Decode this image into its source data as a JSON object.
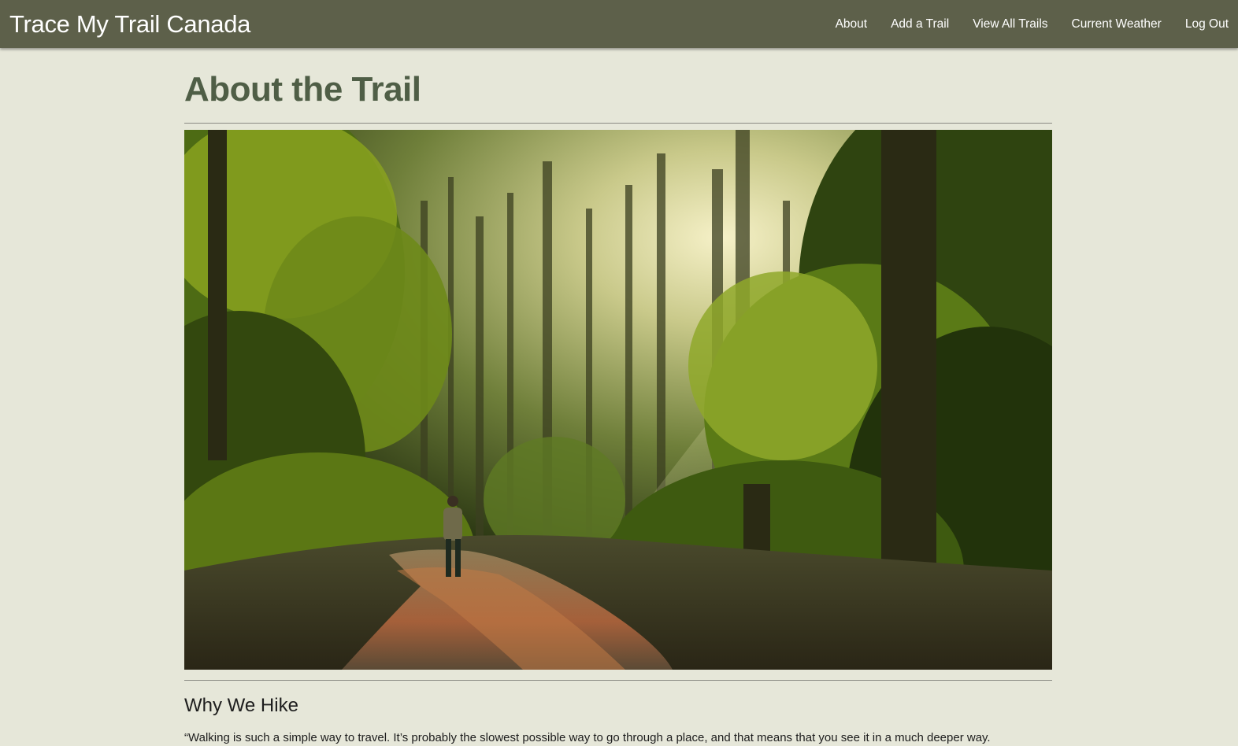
{
  "header": {
    "brand": "Trace My Trail Canada",
    "nav": [
      {
        "label": "About"
      },
      {
        "label": "Add a Trail"
      },
      {
        "label": "View All Trails"
      },
      {
        "label": "Current Weather"
      },
      {
        "label": "Log Out"
      }
    ]
  },
  "main": {
    "title": "About the Trail",
    "hero_image": {
      "subject": "hiker walking a forest trail in morning sunlight"
    },
    "section_heading": "Why We Hike",
    "quote": "“Walking is such a simple way to travel. It’s probably the slowest possible way to go through a place, and that means that you see it in a much deeper way."
  },
  "colors": {
    "navbar": "#5d604a",
    "page_background": "#e6e7d9",
    "title": "#4f5e46"
  }
}
